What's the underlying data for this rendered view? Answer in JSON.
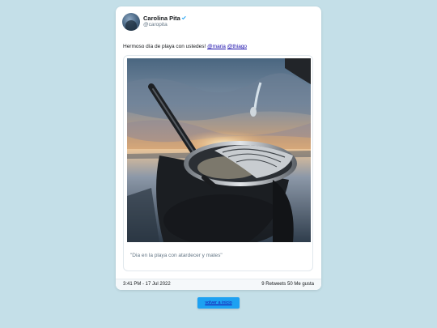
{
  "tweet": {
    "display_name": "Carolina Pita",
    "handle": "@caropita",
    "text_prefix": "Hermoso día de playa con ustedes! ",
    "mentions": [
      "@maria",
      "@thiago"
    ],
    "media": {
      "caption": "\"Dia en la playa con atardecer y mates\""
    },
    "timestamp": "3:41 PM - 17 Jul 2022",
    "stats": "9 Retweets 50 Me gusta"
  },
  "back_button_label": "volver a inicio",
  "colors": {
    "background": "#c4dfe8",
    "card": "#ffffff",
    "verified": "#1da1f2",
    "button": "#1da1f2",
    "link": "#1a0dab"
  },
  "icons": {
    "verified": "verified-checkmark-icon"
  }
}
